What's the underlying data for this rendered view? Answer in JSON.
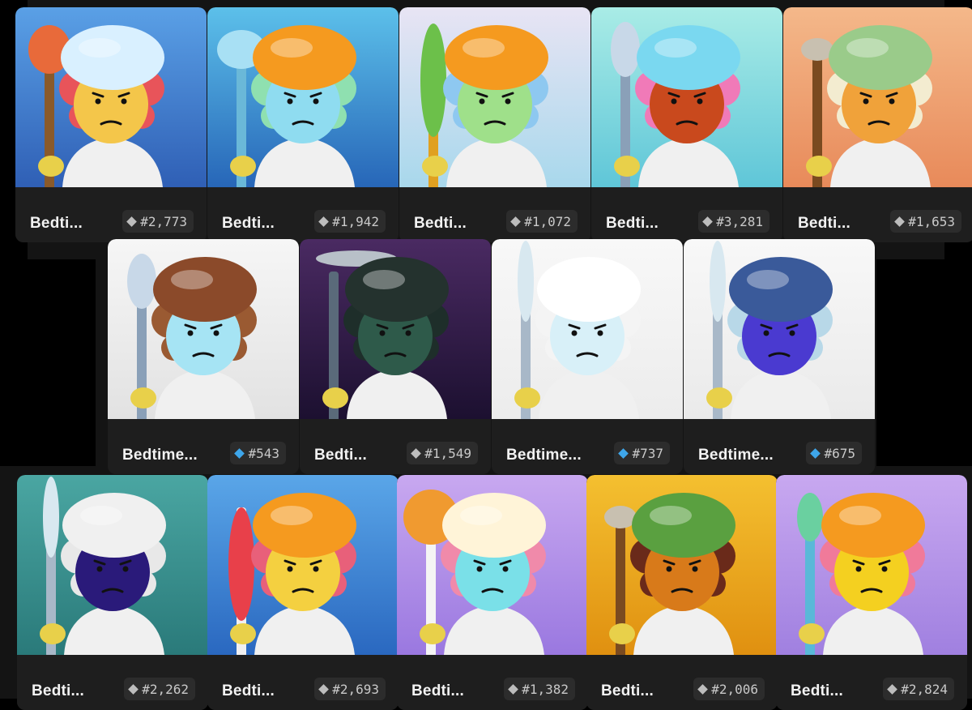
{
  "colors": {
    "gray_gem": "#bdbdbd",
    "rare_gem": "#3ea6ea"
  },
  "cards": [
    {
      "name": "Bedti...",
      "rank": "#2,773",
      "gem": "gray",
      "bg": [
        "#5aa0e6",
        "#2f5fb5"
      ],
      "skin": "#f4c64a",
      "hair": "#e8545a",
      "hat": "#d9f0ff",
      "weapon": "club-icon"
    },
    {
      "name": "Bedti...",
      "rank": "#1,942",
      "gem": "gray",
      "bg": [
        "#5cc0ea",
        "#2766b8"
      ],
      "skin": "#8fdcf0",
      "hair": "#8fe0b0",
      "hat": "#f59a1f",
      "weapon": "hammer-icon"
    },
    {
      "name": "Bedti...",
      "rank": "#1,072",
      "gem": "gray",
      "bg": [
        "#e8e4f4",
        "#a8d8ec"
      ],
      "skin": "#9fe08a",
      "hair": "#8ec8f0",
      "hat": "#f59a1f",
      "weapon": "cactus-club-icon"
    },
    {
      "name": "Bedti...",
      "rank": "#3,281",
      "gem": "gray",
      "bg": [
        "#a9ece6",
        "#5fc6d8"
      ],
      "skin": "#c9491d",
      "hair": "#f07ab8",
      "hat": "#7ad8f0",
      "weapon": "staff-icon"
    },
    {
      "name": "Bedti...",
      "rank": "#1,653",
      "gem": "gray",
      "bg": [
        "#f4b88a",
        "#e88a5a"
      ],
      "skin": "#f0a23a",
      "hair": "#f3ecd0",
      "hat": "#9acb8a",
      "weapon": "wooden-staff-icon"
    },
    {
      "name": "Bedtime...",
      "rank": "#543",
      "gem": "rare",
      "bg": [
        "#f6f6f6",
        "#e2e2e2"
      ],
      "skin": "#a6e4f4",
      "hair": "#9a5a32",
      "hat": "#8b4a2a",
      "weapon": "axe-icon"
    },
    {
      "name": "Bedti...",
      "rank": "#1,549",
      "gem": "gray",
      "bg": [
        "#4a2a62",
        "#1c1030"
      ],
      "skin": "#2e5a4a",
      "hair": "#1e2e2a",
      "hat": "#24322e",
      "weapon": "scythe-icon"
    },
    {
      "name": "Bedtime...",
      "rank": "#737",
      "gem": "rare",
      "bg": [
        "#f8f8f8",
        "#ececec"
      ],
      "skin": "#d8f0f8",
      "hair": "#f4f4f4",
      "hat": "#ffffff",
      "weapon": "trident-icon"
    },
    {
      "name": "Bedtime...",
      "rank": "#675",
      "gem": "rare",
      "bg": [
        "#f8f8f8",
        "#eaeaea"
      ],
      "skin": "#4a3ad0",
      "hair": "#b8d8e8",
      "hat": "#3a5a9a",
      "weapon": "trident-icon"
    },
    {
      "name": "Bedti...",
      "rank": "#2,262",
      "gem": "gray",
      "bg": [
        "#4aa6a2",
        "#2a7a7a"
      ],
      "skin": "#2a1a7a",
      "hair": "#e8e8e8",
      "hat": "#f0f0f0",
      "weapon": "sword-icon"
    },
    {
      "name": "Bedti...",
      "rank": "#2,693",
      "gem": "gray",
      "bg": [
        "#5aa6e8",
        "#2a68c0"
      ],
      "skin": "#f4d040",
      "hair": "#e8607a",
      "hat": "#f59a1f",
      "weapon": "candy-stick-icon"
    },
    {
      "name": "Bedti...",
      "rank": "#1,382",
      "gem": "gray",
      "bg": [
        "#c8a8f0",
        "#9a78e0"
      ],
      "skin": "#7ae0e8",
      "hair": "#f08aaa",
      "hat": "#fff4d8",
      "weapon": "lollipop-icon"
    },
    {
      "name": "Bedti...",
      "rank": "#2,006",
      "gem": "gray",
      "bg": [
        "#f4c030",
        "#e09010"
      ],
      "skin": "#d87a1a",
      "hair": "#6a2a1a",
      "hat": "#5aa040",
      "weapon": "wooden-staff-icon"
    },
    {
      "name": "Bedti...",
      "rank": "#2,824",
      "gem": "gray",
      "bg": [
        "#c8a8f0",
        "#a080e0"
      ],
      "skin": "#f4d020",
      "hair": "#f07a9a",
      "hat": "#f59a1f",
      "weapon": "leaf-staff-icon"
    }
  ]
}
